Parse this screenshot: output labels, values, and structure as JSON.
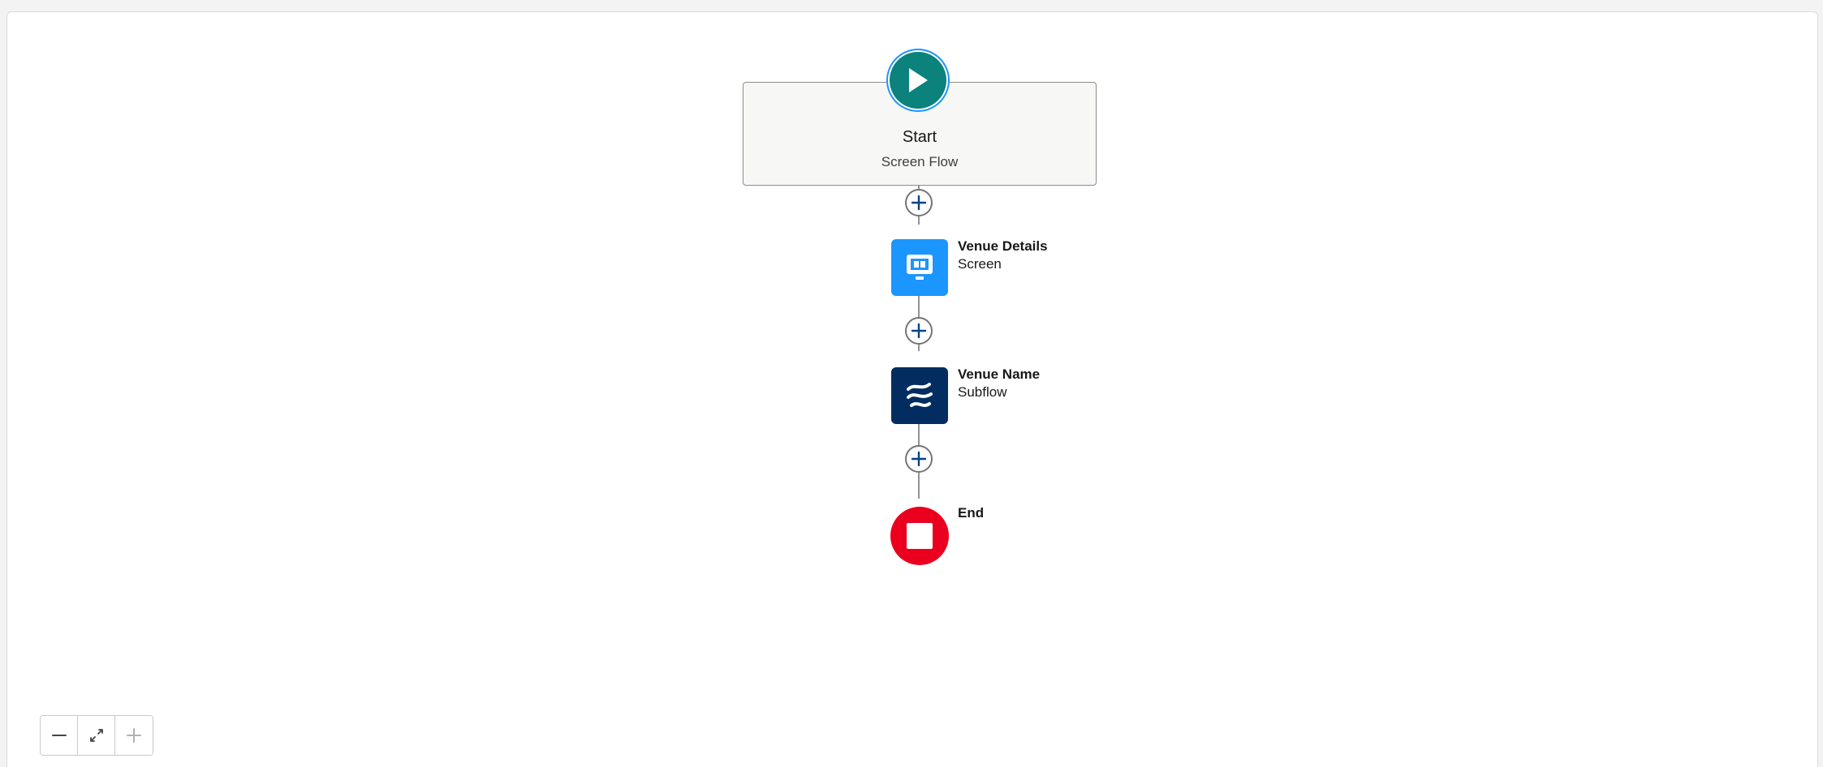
{
  "flow": {
    "start": {
      "title": "Start",
      "subtitle": "Screen Flow",
      "icon": "play-icon",
      "color": "#0b827c"
    },
    "elements": [
      {
        "title": "Venue Details",
        "type": "Screen",
        "icon": "screen-icon",
        "color": "#1b96ff"
      },
      {
        "title": "Venue Name",
        "type": "Subflow",
        "icon": "subflow-icon",
        "color": "#032d60"
      }
    ],
    "end": {
      "title": "End",
      "icon": "stop-icon",
      "color": "#ea001e"
    }
  },
  "zoom_controls": {
    "zoom_out_icon": "minus-icon",
    "fit_icon": "fit-view-icon",
    "zoom_in_icon": "plus-icon"
  }
}
